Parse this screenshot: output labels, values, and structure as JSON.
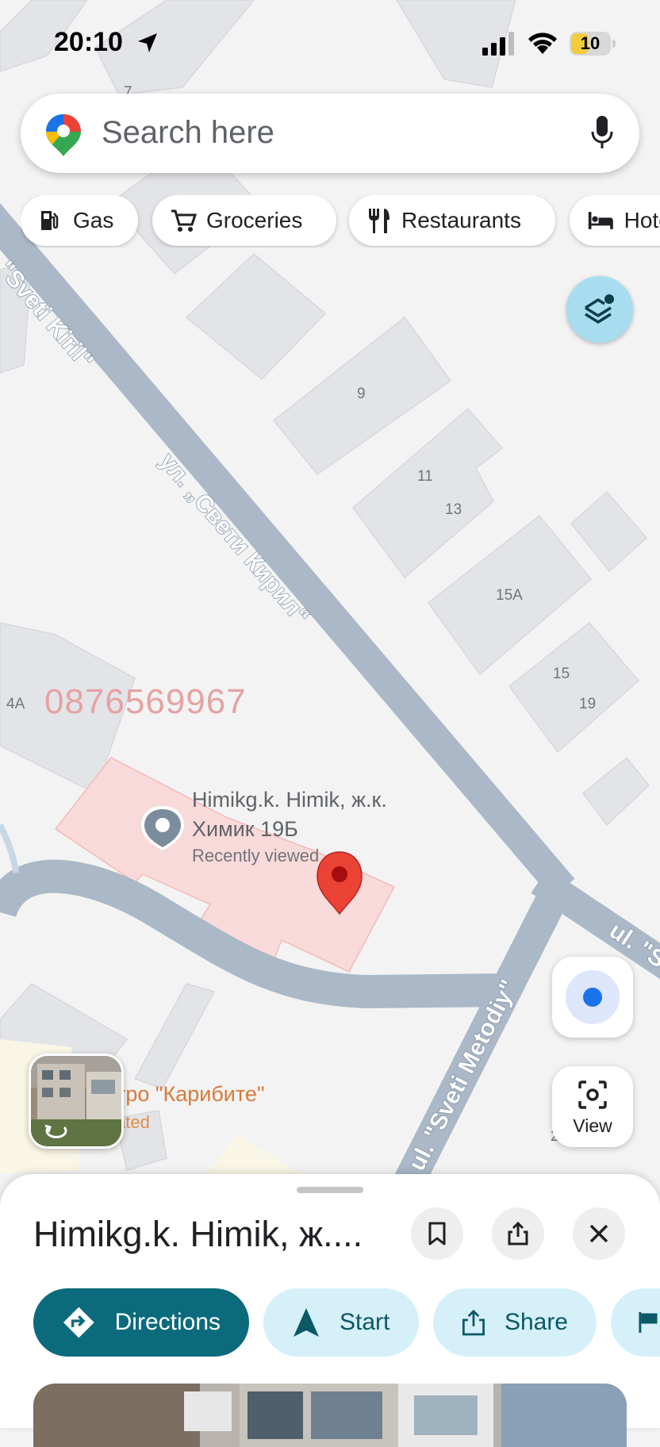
{
  "status_bar": {
    "time": "20:10",
    "battery": "10"
  },
  "search": {
    "placeholder": "Search here"
  },
  "chips": [
    {
      "label": "Gas",
      "icon": "gas-station-icon"
    },
    {
      "label": "Groceries",
      "icon": "cart-icon"
    },
    {
      "label": "Restaurants",
      "icon": "fork-knife-icon"
    },
    {
      "label": "Hotels",
      "icon": "bed-icon"
    }
  ],
  "map": {
    "streets": {
      "sveti_kiril_latin": "\"Sveti Kiril\"",
      "sveti_kiril_cyr": "ул. „Свети Кирил“",
      "sveti_metodiy": "ul. \"Sveti Metodiy\"",
      "ul_right": "ul. \"S"
    },
    "house_numbers": [
      "7",
      "9",
      "11",
      "13",
      "15A",
      "15",
      "19",
      "4A",
      "2"
    ],
    "phone_overlay": "0876569967",
    "place_label": {
      "line1": "Himikg.k. Himik, ж.к.",
      "line2": "Химик 19Б",
      "recent": "Recently viewed"
    },
    "poi": {
      "name": "тро \"Карибите\"",
      "sub": "ated"
    },
    "colors": {
      "road": "#aab8c7",
      "building": "#e3e4e8",
      "highlight": "#f8d9d8",
      "pin": "#ea4335"
    }
  },
  "view_button": {
    "label": "View"
  },
  "sheet": {
    "title": "Himikg.k. Himik, ж....",
    "actions": [
      {
        "label": "Directions",
        "icon": "directions-icon"
      },
      {
        "label": "Start",
        "icon": "navigation-arrow-icon"
      },
      {
        "label": "Share",
        "icon": "share-icon"
      },
      {
        "label": "",
        "icon": "flag-icon"
      }
    ]
  }
}
